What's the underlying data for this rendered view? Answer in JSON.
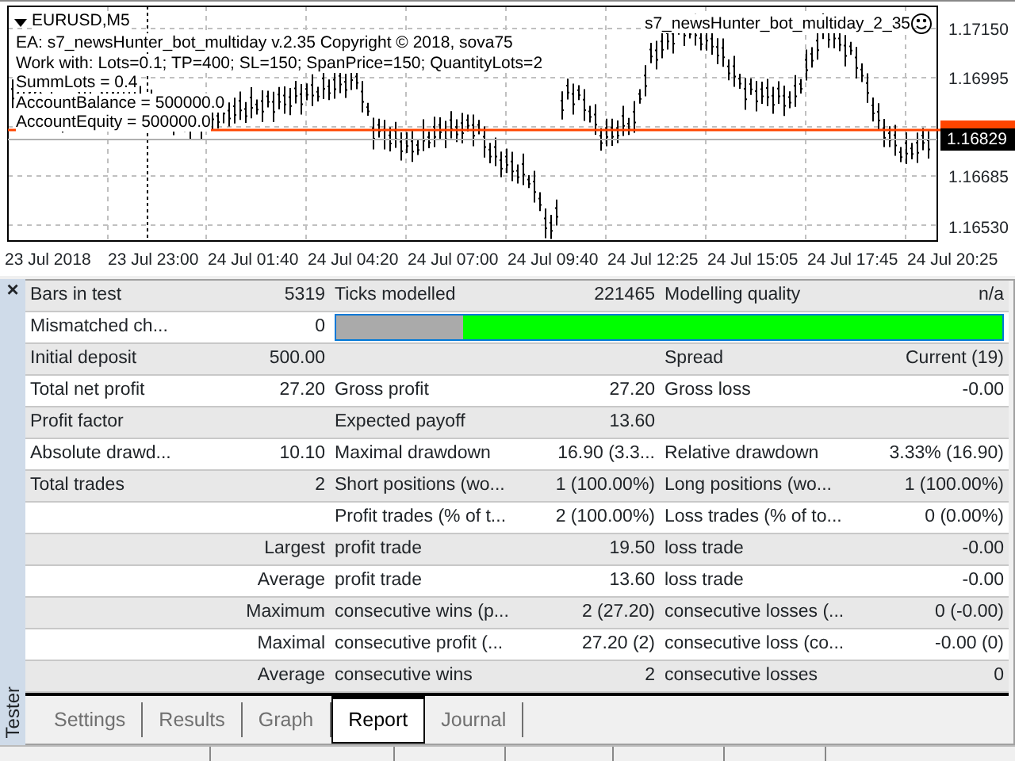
{
  "chart": {
    "symbol": "EURUSD,M5",
    "ea_name": "s7_newsHunter_bot_multiday_2_35",
    "info_lines": [
      "EA: s7_newsHunter_bot_multiday v.2.35 Copyright © 2018, sova75",
      "Work with: Lots=0.1; TP=400; SL=150; SpanPrice=150; QuantityLots=2",
      "SummLots = 0.4",
      "AccountBalance = 500000.0",
      "AccountEquity = 500000.0"
    ],
    "price_labels": [
      "1.17150",
      "1.16995",
      "1.16685",
      "1.16530"
    ],
    "current_price": "1.16829",
    "time_labels": [
      "23 Jul 2018",
      "23 Jul 23:00",
      "24 Jul 01:40",
      "24 Jul 04:20",
      "24 Jul 07:00",
      "24 Jul 09:40",
      "24 Jul 12:25",
      "24 Jul 15:05",
      "24 Jul 17:45",
      "24 Jul 20:25"
    ]
  },
  "tester": {
    "close_glyph": "×",
    "title": "Tester",
    "rows": [
      {
        "kind": "stats",
        "col_1": "Bars in test",
        "col_2": "5319",
        "col_3": "Ticks modelled",
        "col_4": "221465",
        "col_5": "Modelling quality",
        "col_6": "n/a"
      },
      {
        "kind": "quality",
        "col_1": "Mismatched ch...",
        "col_2": "0",
        "level": 0.81
      },
      {
        "kind": "stats",
        "col_1": "Initial deposit",
        "col_2": "500.00",
        "col_5": "Spread",
        "col_6": "Current (19)"
      },
      {
        "kind": "stats",
        "col_1": "Total net profit",
        "col_2": "27.20",
        "col_3": "Gross profit",
        "col_4": "27.20",
        "col_5": "Gross loss",
        "col_6": "-0.00"
      },
      {
        "kind": "stats",
        "col_1": "Profit factor",
        "col_3": "Expected payoff",
        "col_4": "13.60"
      },
      {
        "kind": "stats",
        "col_1": "Absolute drawd...",
        "col_2": "10.10",
        "col_3": "Maximal drawdown",
        "col_4": "16.90 (3.3...",
        "col_5": "Relative drawdown",
        "col_6": "3.33% (16.90)"
      },
      {
        "kind": "stats",
        "col_1": "Total trades",
        "col_2": "2",
        "col_3": "Short positions (wo...",
        "col_4": "1 (100.00%)",
        "col_5": "Long positions (wo...",
        "col_6": "1 (100.00%)"
      },
      {
        "kind": "stats",
        "col_3": "Profit trades (% of t...",
        "col_4": "2 (100.00%)",
        "col_5": "Loss trades (% of to...",
        "col_6": "0 (0.00%)"
      },
      {
        "kind": "detail",
        "col_1": "Largest",
        "col_3": "profit trade",
        "col_4": "19.50",
        "col_5": "loss trade",
        "col_6": "-0.00"
      },
      {
        "kind": "detail",
        "col_1": "Average",
        "col_3": "profit trade",
        "col_4": "13.60",
        "col_5": "loss trade",
        "col_6": "-0.00"
      },
      {
        "kind": "detail",
        "col_1": "Maximum",
        "col_3": "consecutive wins (p...",
        "col_4": "2 (27.20)",
        "col_5": "consecutive losses (...",
        "col_6": "0 (-0.00)"
      },
      {
        "kind": "detail",
        "col_1": "Maximal",
        "col_3": "consecutive profit (...",
        "col_4": "27.20 (2)",
        "col_5": "consecutive loss (co...",
        "col_6": "-0.00 (0)"
      },
      {
        "kind": "detail",
        "col_1": "Average",
        "col_3": "consecutive wins",
        "col_4": "2",
        "col_5": "consecutive losses",
        "col_6": "0"
      }
    ],
    "tabs": [
      {
        "label": "Settings",
        "selected": false
      },
      {
        "label": "Results",
        "selected": false
      },
      {
        "label": "Graph",
        "selected": false
      },
      {
        "label": "Report",
        "selected": true
      },
      {
        "label": "Journal",
        "selected": false
      }
    ]
  }
}
